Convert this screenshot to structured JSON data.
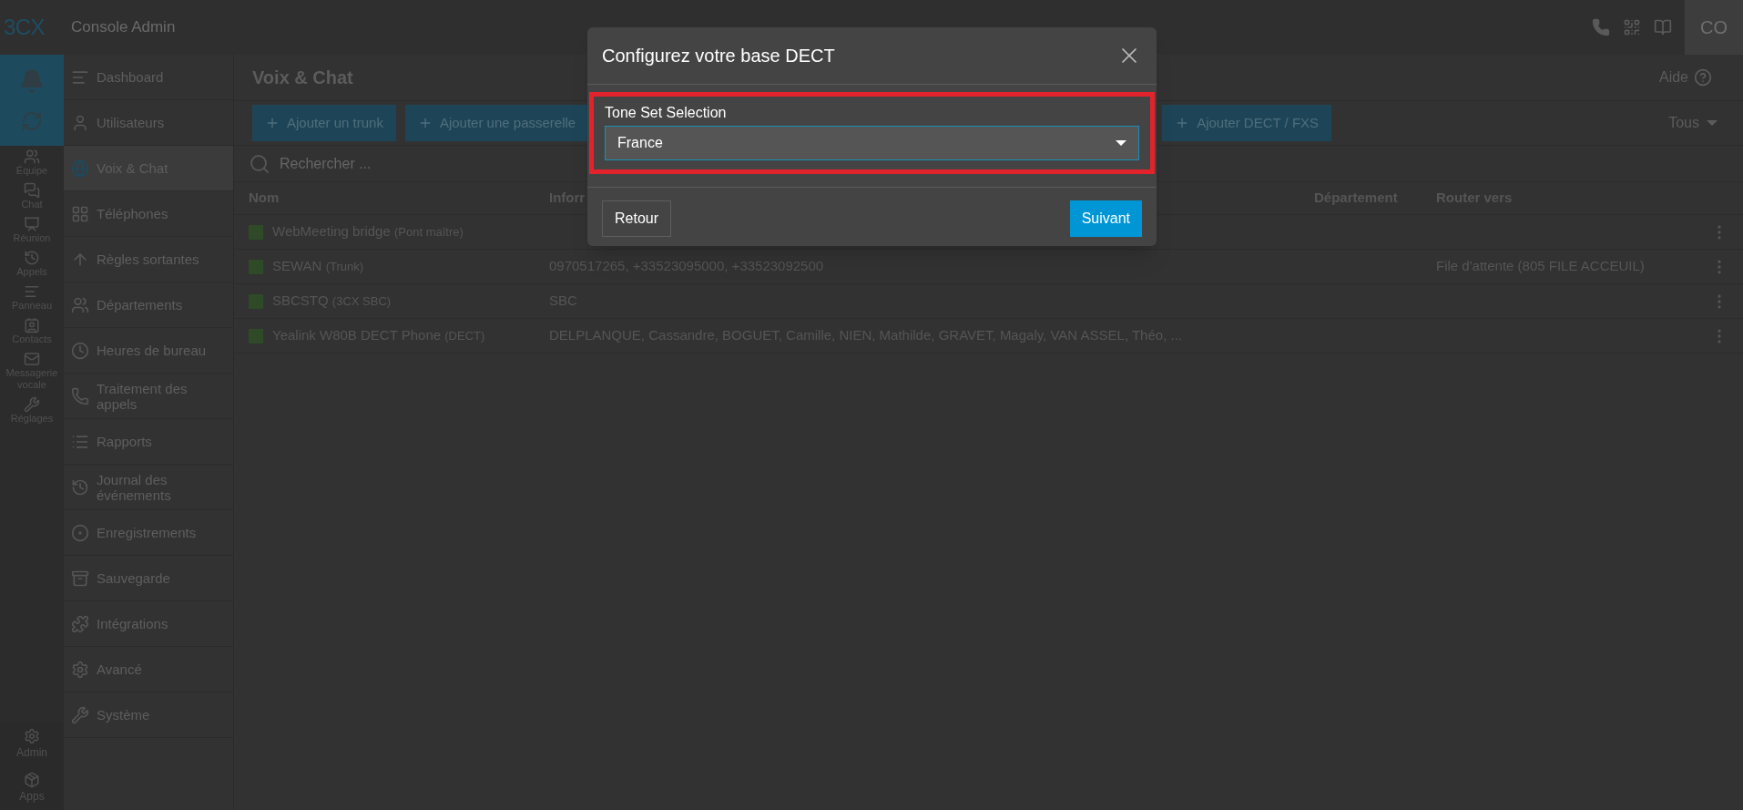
{
  "topbar": {
    "brand": "3CX",
    "title": "Console Admin",
    "user_initials": "CO"
  },
  "rail": {
    "items": [
      "Équipe",
      "Chat",
      "Réunion",
      "Appels",
      "Panneau",
      "Contacts",
      "Messagerie vocale",
      "Réglages"
    ],
    "bottom": [
      "Admin",
      "Apps"
    ]
  },
  "sidebar": {
    "items": [
      {
        "label": "Dashboard",
        "selected": false
      },
      {
        "label": "Utilisateurs",
        "selected": false
      },
      {
        "label": "Voix & Chat",
        "selected": true
      },
      {
        "label": "Téléphones",
        "selected": false
      },
      {
        "label": "Règles sortantes",
        "selected": false
      },
      {
        "label": "Départements",
        "selected": false
      },
      {
        "label": "Heures de bureau",
        "selected": false
      },
      {
        "label": "Traitement des appels",
        "selected": false
      },
      {
        "label": "Rapports",
        "selected": false
      },
      {
        "label": "Journal des événements",
        "selected": false
      },
      {
        "label": "Enregistrements",
        "selected": false
      },
      {
        "label": "Sauvegarde",
        "selected": false
      },
      {
        "label": "Intégrations",
        "selected": false
      },
      {
        "label": "Avancé",
        "selected": false
      },
      {
        "label": "Système",
        "selected": false
      }
    ]
  },
  "page": {
    "title": "Voix & Chat",
    "help": "Aide",
    "toolbar": [
      "Ajouter un trunk",
      "Ajouter une passerelle"
    ],
    "toolbar_right": "Ajouter DECT / FXS",
    "filter": "Tous",
    "search": {
      "placeholder": "Rechercher ..."
    },
    "table": {
      "columns": [
        "Nom",
        "Inforr",
        "Département",
        "Router vers"
      ],
      "rows": [
        {
          "name": "WebMeeting bridge",
          "type": "(Pont maître)",
          "info": "",
          "route": ""
        },
        {
          "name": "SEWAN",
          "type": "(Trunk)",
          "info": "0970517265, +33523095000, +33523092500",
          "route": "File d'attente (805 FILE ACCEUIL)"
        },
        {
          "name": "SBCSTQ",
          "type": "(3CX SBC)",
          "info": "SBC",
          "route": ""
        },
        {
          "name": "Yealink W80B DECT Phone",
          "type": "(DECT)",
          "info": "DELPLANQUE, Cassandre, BOGUET, Camille, NIEN, Mathilde, GRAVET, Magaly, VAN ASSEL, Théo, ...",
          "route": ""
        }
      ]
    }
  },
  "modal": {
    "title": "Configurez votre base DECT",
    "field_label": "Tone Set Selection",
    "value": "France",
    "back": "Retour",
    "next": "Suivant"
  }
}
